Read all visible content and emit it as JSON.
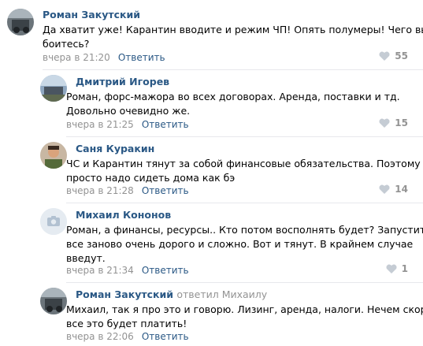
{
  "comments": [
    {
      "author": "Роман Закутский",
      "reply_to": "",
      "text_lines": [
        "Да хватит уже! Карантин вводите и режим ЧП! Опять полумеры! Чего вы",
        "боитесь?"
      ],
      "time": "вчера в 21:20",
      "reply_label": "Ответить",
      "likes": "55"
    },
    {
      "author": "Дмитрий Игорев",
      "reply_to": "",
      "text_lines": [
        "Роман, форс-мажора во всех договорах. Аренда, поставки и тд.",
        "Довольно очевидно же."
      ],
      "time": "вчера в 21:25",
      "reply_label": "Ответить",
      "likes": "15"
    },
    {
      "author": "Саня Куракин",
      "reply_to": "",
      "text_lines": [
        "ЧС и Карантин тянут за собой финансовые обязательства. Поэтому",
        "просто надо сидеть дома как бэ"
      ],
      "time": "вчера в 21:28",
      "reply_label": "Ответить",
      "likes": "14"
    },
    {
      "author": "Михаил Кононов",
      "reply_to": "",
      "text_lines": [
        "Роман, а финансы, ресурсы.. Кто потом восполнять будет? Запустить",
        "все заново очень дорого и сложно. Вот и тянут. В крайнем случае",
        "введут."
      ],
      "time": "вчера в 21:34",
      "reply_label": "Ответить",
      "likes": "1"
    },
    {
      "author": "Роман Закутский",
      "reply_to": "ответил Михаилу",
      "text_lines": [
        "Михаил, так я про это и говорю. Лизинг, аренда, налоги. Нечем скоро",
        "все это будет платить!"
      ],
      "time": "вчера в 22:06",
      "reply_label": "Ответить",
      "likes": ""
    }
  ],
  "icons": {
    "like": "heart-icon",
    "no_photo": "camera-icon"
  },
  "colors": {
    "link": "#2a5885",
    "meta": "#939393",
    "divider": "#e7e8ec"
  }
}
